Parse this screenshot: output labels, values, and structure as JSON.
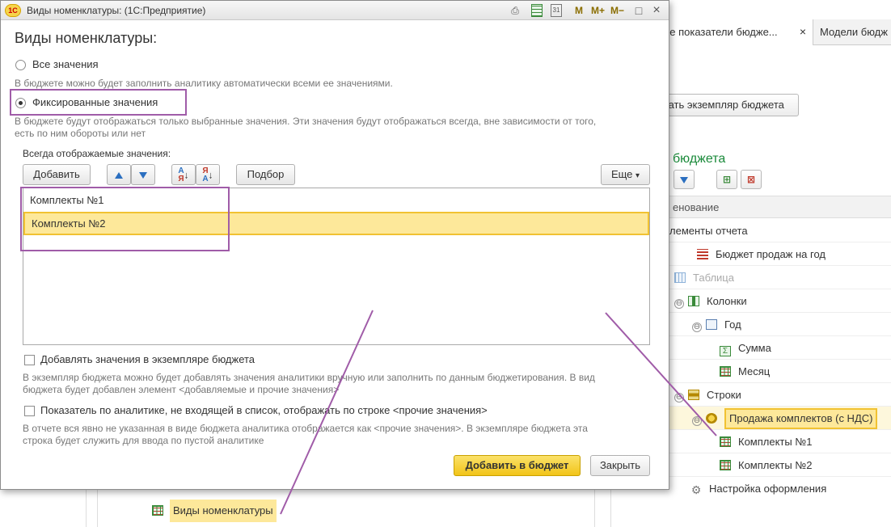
{
  "background": {
    "tabs": [
      {
        "label": "вые показатели бюдже...",
        "close": "×"
      },
      {
        "label": "Модели бюдж"
      }
    ],
    "create_instance_button": "дать экземпляр бюджета",
    "section_title": "бюджета",
    "tree_header": "енование",
    "tree": [
      {
        "label": "лементы отчета"
      },
      {
        "label": "Бюджет продаж на год"
      },
      {
        "label": "Таблица"
      },
      {
        "label": "Колонки",
        "toggle": "⊖"
      },
      {
        "label": "Год",
        "toggle": "⊖"
      },
      {
        "label": "Сумма",
        "icon": "Σ"
      },
      {
        "label": "Месяц"
      },
      {
        "label": "Строки",
        "toggle": "⊖"
      },
      {
        "label": "Продажа комплектов (с НДС)",
        "toggle": "⊖"
      },
      {
        "label": "Комплекты №1"
      },
      {
        "label": "Комплекты №2"
      },
      {
        "label": "Настройка оформления"
      }
    ],
    "bottom_item": "Виды номенклатуры"
  },
  "dialog": {
    "logo": "1С",
    "window_title": "Виды номенклатуры: (1С:Предприятие)",
    "title_tools": {
      "m": "M",
      "m_plus": "M+",
      "m_minus": "M−",
      "restore": "□",
      "close": "×"
    },
    "heading": "Виды номенклатуры:",
    "radio_all_label": "Все значения",
    "radio_all_hint": "В бюджете можно будет заполнить аналитику автоматически всеми ее значениями.",
    "radio_fixed_label": "Фиксированные значения",
    "radio_fixed_hint_1": "В бюджете будут отображаться только выбранные значения. Эти значения будут отображаться всегда, вне зависимости от того,",
    "radio_fixed_hint_2": "есть по ним обороты или нет",
    "selected_mode": "fixed",
    "always_shown_label": "Всегда отображаемые значения:",
    "toolbar": {
      "add": "Добавить",
      "pick": "Подбор",
      "more": "Еще",
      "more_chevron": "▾",
      "sort_asc_top": "А",
      "sort_asc_bottom": "Я",
      "sort_desc_top": "Я",
      "sort_desc_bottom": "А"
    },
    "values": [
      {
        "label": "Комплекты №1",
        "selected": false
      },
      {
        "label": "Комплекты №2",
        "selected": true
      }
    ],
    "add_values_checkbox": "Добавлять значения в экземпляре бюджета",
    "add_values_checked": false,
    "add_values_hint_1": "В экземпляр бюджета можно будет добавлять значения аналитики вручную или заполнить по данным бюджетирования. В вид",
    "add_values_hint_2": "бюджета будет добавлен элемент <добавляемые и прочие значения>",
    "other_values_checkbox": "Показатель по аналитике, не входящей в список, отображать по строке <прочие значения>",
    "other_values_checked": false,
    "other_values_hint_1": "В отчете вся явно не указанная в виде бюджета аналитика отображается как <прочие значения>. В экземпляре бюджета эта",
    "other_values_hint_2": "строка будет служить для ввода по пустой аналитике",
    "add_to_budget_button": "Добавить в бюджет",
    "close_button": "Закрыть"
  },
  "colors": {
    "accent_yellow": "#f2c418",
    "annotation_purple": "#a05ca8",
    "green_title": "#1a8a3a"
  }
}
